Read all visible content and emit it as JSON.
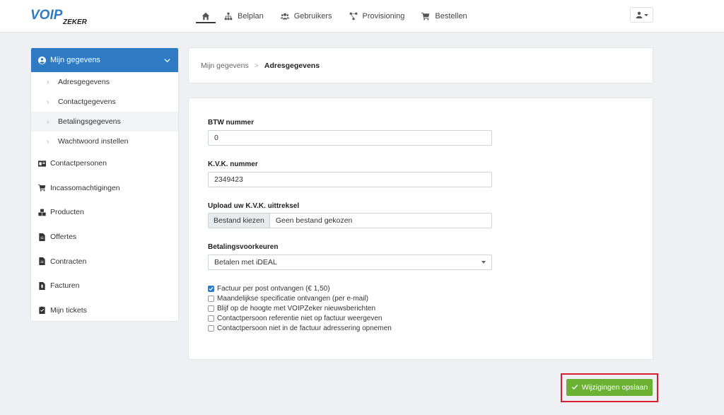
{
  "brand": {
    "logo_main": "VOIP",
    "logo_sub": "ZEKER",
    "color_blue": "#2e7bc4",
    "color_green": "#6bb234"
  },
  "nav": {
    "items": [
      {
        "label": "",
        "icon": "home-icon"
      },
      {
        "label": "Belplan",
        "icon": "sitemap-icon"
      },
      {
        "label": "Gebruikers",
        "icon": "users-icon"
      },
      {
        "label": "Provisioning",
        "icon": "network-icon"
      },
      {
        "label": "Bestellen",
        "icon": "cart-icon"
      }
    ]
  },
  "sidebar": {
    "header": "Mijn gegevens",
    "subitems": [
      "Adresgegevens",
      "Contactgegevens",
      "Betalingsgegevens",
      "Wachtwoord instellen"
    ],
    "items": [
      "Contactpersonen",
      "Incassomachtigingen",
      "Producten",
      "Offertes",
      "Contracten",
      "Facturen",
      "Mijn tickets"
    ]
  },
  "breadcrumb": {
    "first": "Mijn gegevens",
    "separator": ">",
    "current": "Adresgegevens"
  },
  "form": {
    "btw_label": "BTW nummer",
    "btw_value": "0",
    "kvk_label": "K.V.K. nummer",
    "kvk_value": "2349423",
    "upload_label": "Upload uw K.V.K. uittreksel",
    "upload_button": "Bestand kiezen",
    "upload_filename": "Geen bestand gekozen",
    "pref_label": "Betalingsvoorkeuren",
    "pref_value": "Betalen met iDEAL",
    "checkboxes": [
      {
        "label": "Factuur per post ontvangen (€ 1,50)",
        "checked": true
      },
      {
        "label": "Maandelijkse specificatie ontvangen (per e-mail)",
        "checked": false
      },
      {
        "label": "Blijf op de hoogte met VOIPZeker nieuwsberichten",
        "checked": false
      },
      {
        "label": "Contactpersoon referentie niet op factuur weergeven",
        "checked": false
      },
      {
        "label": "Contactpersoon niet in de factuur adressering opnemen",
        "checked": false
      }
    ]
  },
  "save_label": "Wijzigingen opslaan"
}
